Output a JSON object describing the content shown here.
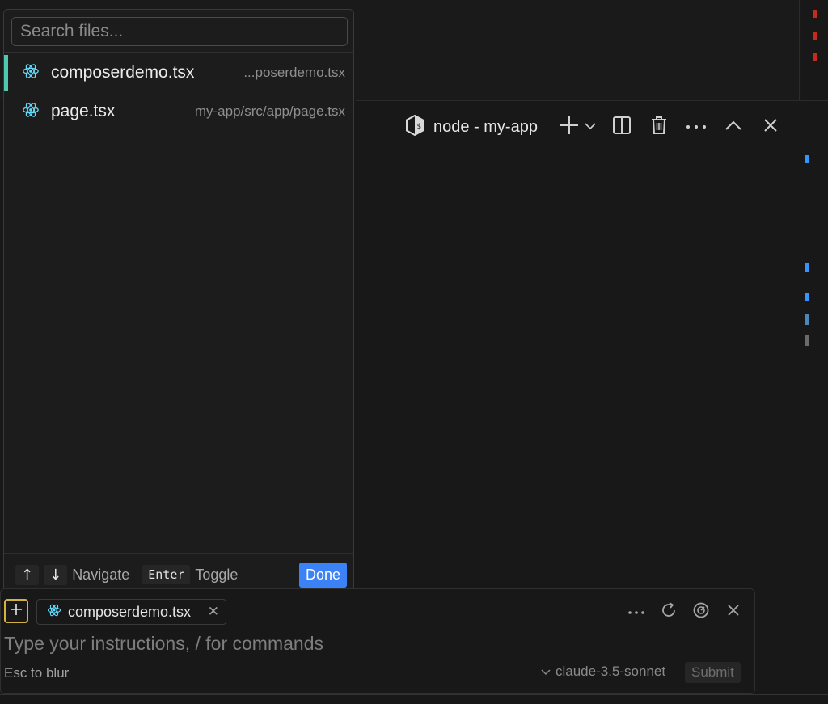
{
  "colors": {
    "accent_blue": "#3b82f6",
    "active_bar": "#4ec9b0",
    "react_icon": "#61dafb",
    "add_context_border": "#d4b144",
    "scroll_marker_red": "#c42b1c",
    "scroll_marker_blue": "#3794ff"
  },
  "picker": {
    "search": {
      "placeholder": "Search files...",
      "value": ""
    },
    "files": [
      {
        "name": "composerdemo.tsx",
        "path": "...poserdemo.tsx",
        "icon": "react-icon",
        "active": true
      },
      {
        "name": "page.tsx",
        "path": "my-app/src/app/page.tsx",
        "icon": "react-icon",
        "active": false
      }
    ],
    "footer": {
      "up_key": "↑",
      "down_key": "↓",
      "navigate_label": "Navigate",
      "enter_key": "Enter",
      "toggle_label": "Toggle",
      "done_label": "Done"
    }
  },
  "terminal": {
    "title": "node - my-app",
    "icon": "terminal-hexagon-icon"
  },
  "composer": {
    "context_chip": {
      "label": "composerdemo.tsx",
      "icon": "react-icon"
    },
    "instructions_placeholder": "Type your instructions, / for commands",
    "esc_hint": "Esc to blur",
    "model": "claude-3.5-sonnet",
    "submit_label": "Submit"
  }
}
